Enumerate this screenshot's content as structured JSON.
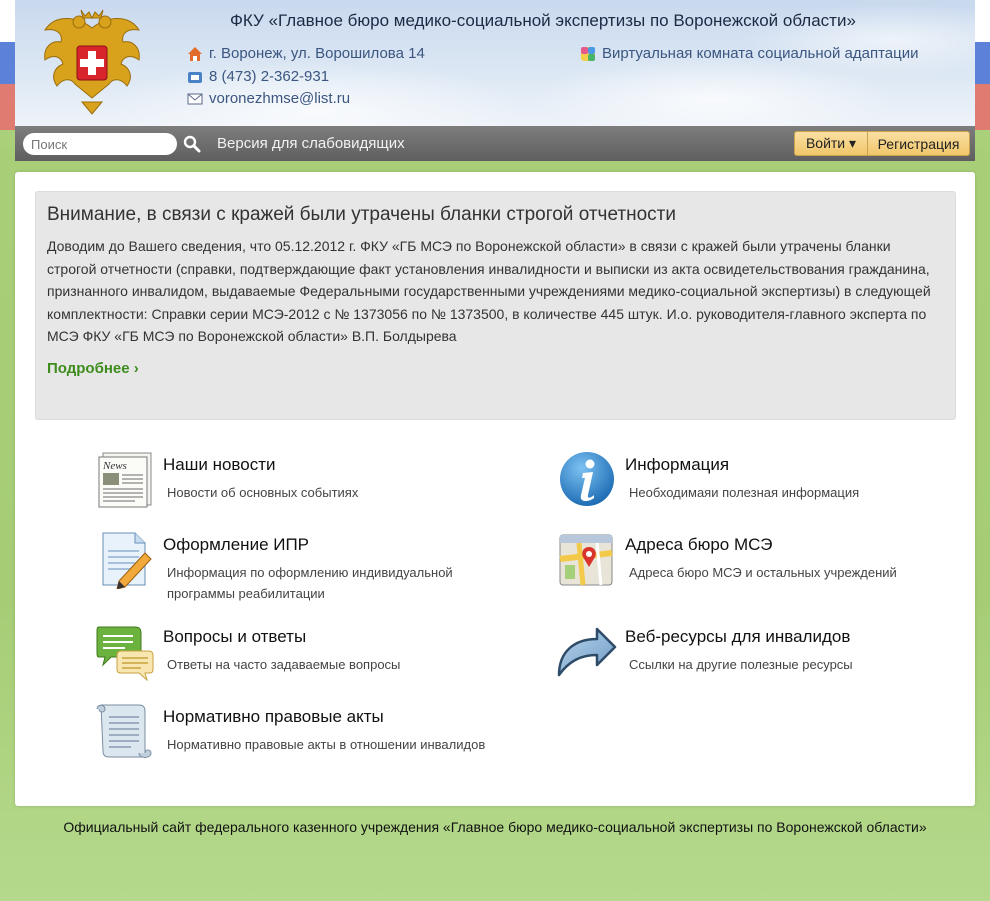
{
  "header": {
    "title": "ФКУ «Главное бюро медико-социальной экспертизы по Воронежской области»",
    "address": "г. Воронеж, ул. Ворошилова 14",
    "phone": "8 (473) 2-362-931",
    "email": "voronezhmse@list.ru",
    "virtual_room": "Виртуальная комната социальной адаптации"
  },
  "navbar": {
    "search_placeholder": "Поиск",
    "low_vision": "Версия для слабовидящих",
    "login": "Войти ▾",
    "register": "Регистрация"
  },
  "notice": {
    "title": "Внимание, в связи с кражей были утрачены бланки строгой отчетности",
    "text": "Доводим до Вашего сведения, что 05.12.2012 г. ФКУ «ГБ МСЭ по Воронежской области» в связи с кражей были утрачены бланки строгой отчетности (справки, подтверждающие факт установления инвалидности и выписки из акта освидетельствования гражданина, признанного инвалидом, выдаваемые Федеральными государственными учреждениями медико-социальной экспертизы) в следующей комплектности: Справки серии МСЭ-2012 с № 1373056 по № 1373500, в количестве 445 штук. И.о. руководителя-главного эксперта по МСЭ ФКУ «ГБ МСЭ по Воронежской области» В.П. Болдырева",
    "more": "Подробнее ›"
  },
  "tiles": [
    {
      "title": "Наши новости",
      "desc": "Новости об основных событиях",
      "icon": "newspaper-icon"
    },
    {
      "title": "Информация",
      "desc": "Необходимаяи полезная информация",
      "icon": "info-icon"
    },
    {
      "title": "Оформление ИПР",
      "desc": "Информация по оформлению индивидуальной программы реабилитации",
      "icon": "document-pencil-icon"
    },
    {
      "title": "Адреса бюро МСЭ",
      "desc": "Адреса бюро МСЭ и остальных учреждений",
      "icon": "map-pin-icon"
    },
    {
      "title": "Вопросы и ответы",
      "desc": "Ответы на часто задаваемые вопросы",
      "icon": "chat-bubbles-icon"
    },
    {
      "title": "Веб-ресурсы для инвалидов",
      "desc": "Ссылки на другие полезные ресурсы",
      "icon": "curved-arrow-icon"
    },
    {
      "title": "Нормативно правовые акты",
      "desc": "Нормативно правовые акты в отношении инвалидов",
      "icon": "scroll-icon"
    }
  ],
  "footer": {
    "text": "Официальный сайт федерального казенного учреждения «Главное бюро медико-социальной экспертизы по Воронежской области»"
  },
  "colors": {
    "link_green": "#3d8c1d",
    "contact_blue": "#3b5680",
    "button_gold": "#f0c66a",
    "background_green": "#a8cf78"
  }
}
